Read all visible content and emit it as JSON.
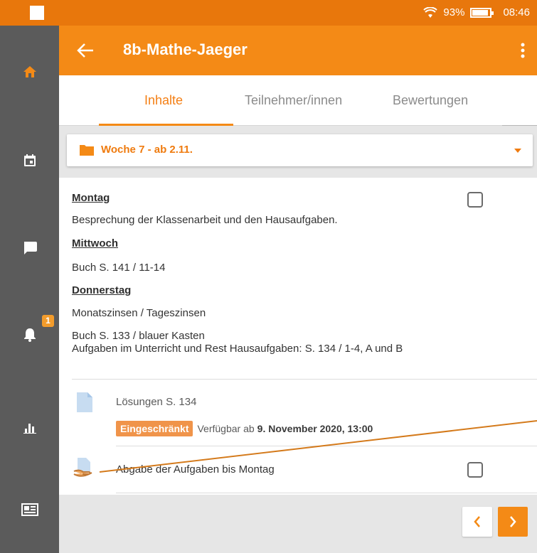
{
  "status": {
    "battery": "93%",
    "time": "08:46"
  },
  "sidebar": {
    "items": [
      {
        "icon": "home-icon"
      },
      {
        "icon": "calendar-icon"
      },
      {
        "icon": "chat-icon"
      },
      {
        "icon": "bell-icon",
        "badge": "1"
      },
      {
        "icon": "stats-icon"
      },
      {
        "icon": "news-icon"
      }
    ]
  },
  "app_bar": {
    "title": "8b-Mathe-Jaeger"
  },
  "tabs": [
    {
      "label": "Inhalte",
      "active": true
    },
    {
      "label": "Teilnehmer/innen",
      "active": false
    },
    {
      "label": "Bewertungen",
      "active": false
    }
  ],
  "section_select": {
    "label": "Woche 7 - ab 2.11."
  },
  "content": {
    "montag": "Montag",
    "montag_text": "Besprechung der Klassenarbeit und den Hausaufgaben.",
    "mittwoch": "Mittwoch",
    "mittwoch_text": "Buch S. 141 / 11-14",
    "donnerstag": "Donnerstag",
    "donnerstag_text1": "Monatszinsen / Tageszinsen",
    "donnerstag_text2": "Buch S. 133 / blauer Kasten",
    "donnerstag_text3": "Aufgaben im Unterricht und Rest Hausaufgaben: S. 134 / 1-4, A und B"
  },
  "resource": {
    "title": "Lösungen S. 134",
    "badge": "Eingeschränkt",
    "availability_prefix": "Verfügbar ab",
    "availability_date": "9. November 2020, 13:00"
  },
  "assignment": {
    "title": "Abgabe der Aufgaben bis Montag"
  },
  "colors": {
    "accent": "#f48a16",
    "sidebar": "#5b5b5b",
    "status_bar": "#e8770c"
  }
}
